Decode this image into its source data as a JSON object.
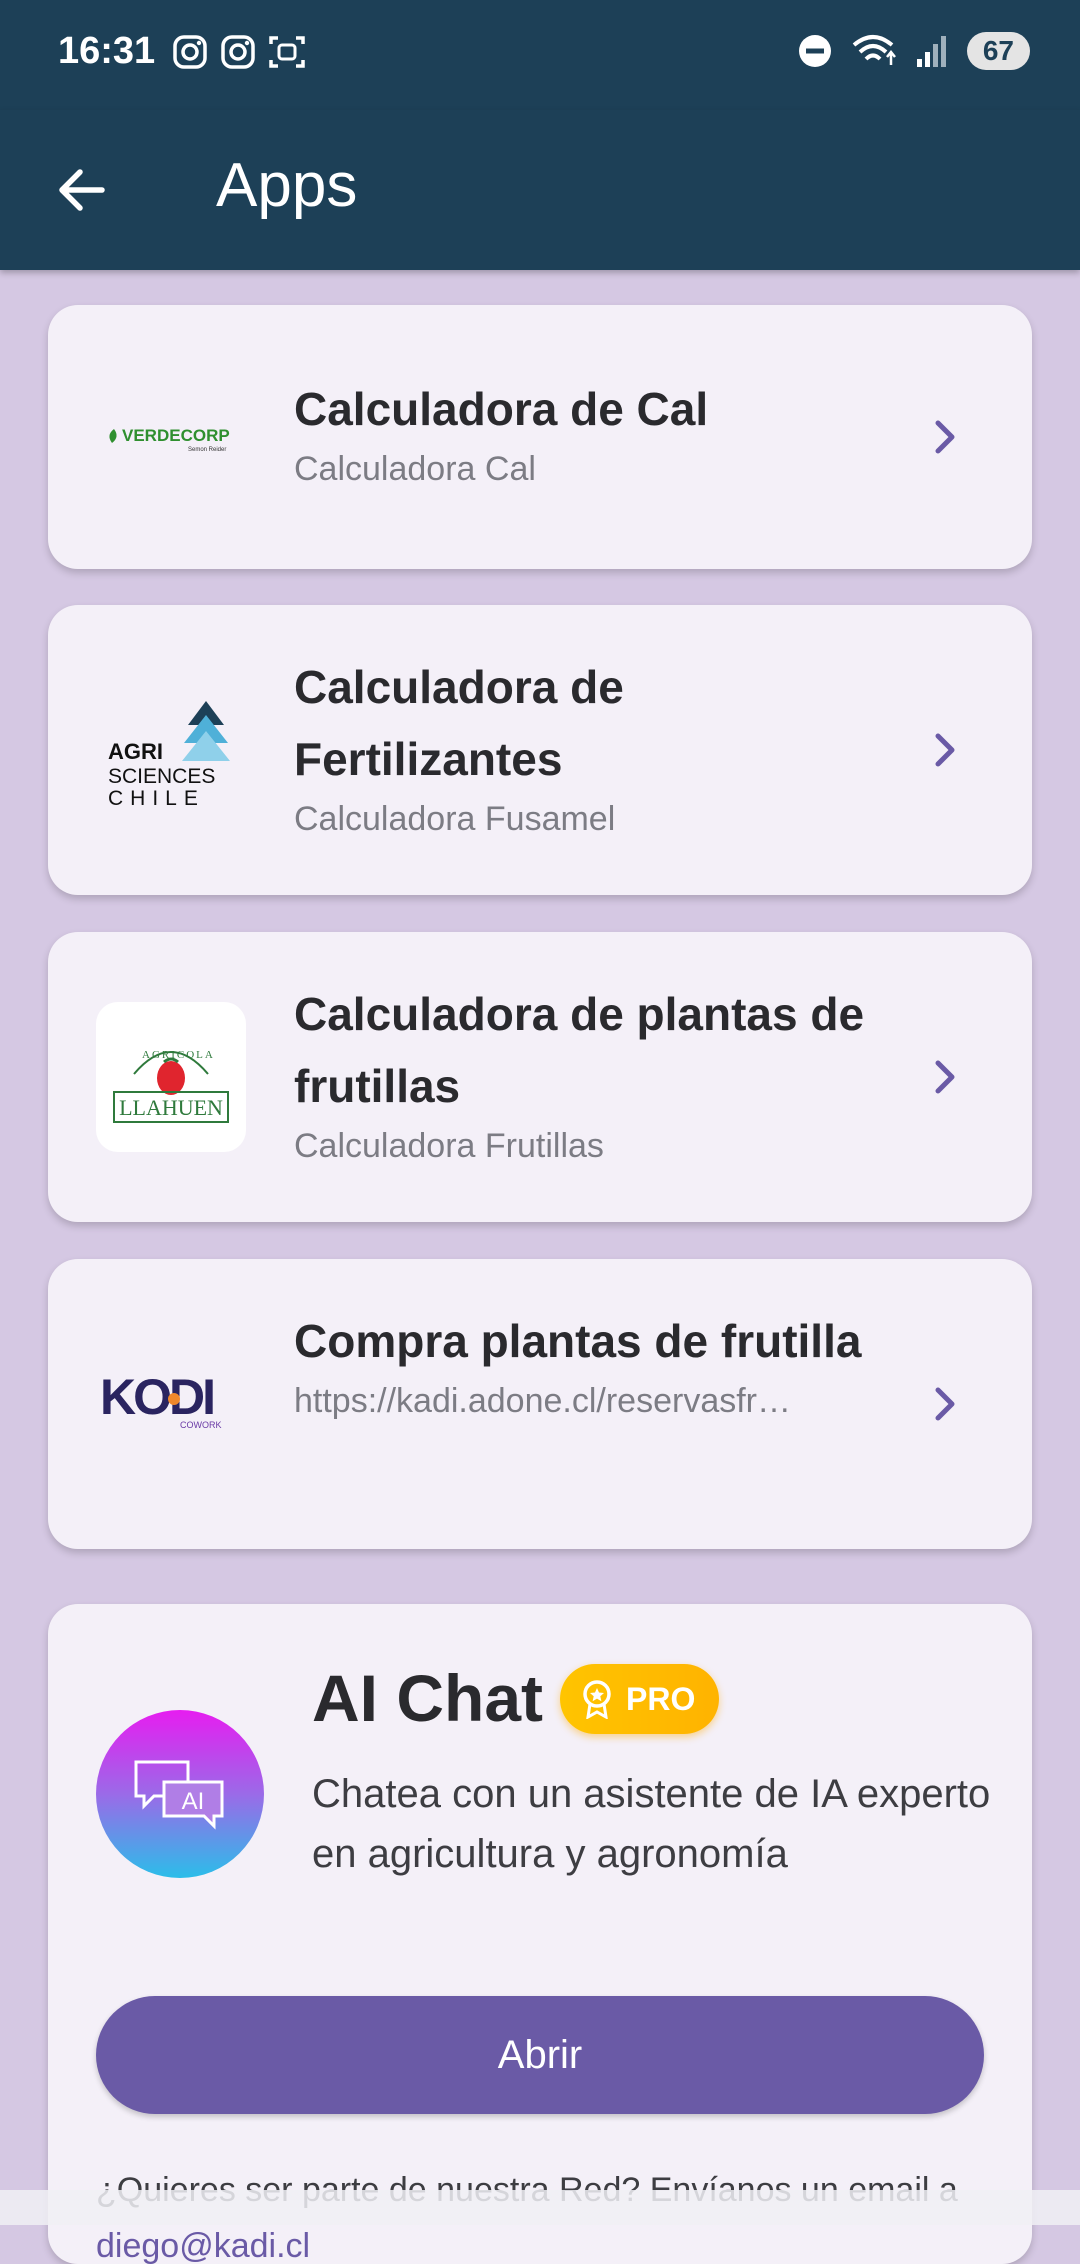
{
  "status_bar": {
    "time": "16:31",
    "battery": "67",
    "left_icons": [
      "instagram-icon",
      "instagram-icon",
      "screenshot-icon"
    ],
    "right_icons": [
      "do-not-disturb-icon",
      "wifi-icon",
      "signal-icon"
    ]
  },
  "app_bar": {
    "title": "Apps",
    "back_icon": "arrow-back-icon",
    "color": "#1d4057"
  },
  "apps": [
    {
      "title": "Calculadora de Cal",
      "subtitle": "Calculadora Cal",
      "logo_text": "VERDECORP",
      "logo_sub": "Semon Reider"
    },
    {
      "title": "Calculadora de Fertilizantes",
      "subtitle": "Calculadora Fusamel",
      "logo_lines": [
        "AGRI",
        "SCIENCES",
        "CHILE"
      ]
    },
    {
      "title": "Calculadora de plantas de frutillas",
      "subtitle": "Calculadora Frutillas",
      "logo_arc": "AGRICOLA",
      "logo_text": "LLAHUEN"
    },
    {
      "title": "Compra plantas de frutilla",
      "subtitle": "https://kadi.adone.cl/reservasfr…",
      "logo_text": "KODI",
      "logo_sub": "COWORK"
    }
  ],
  "ai_chat": {
    "title": "AI Chat",
    "badge": "PRO",
    "avatar_label": "AI",
    "description": "Chatea con un asistente de IA experto en agricultura y agronomía",
    "button": "Abrir",
    "footer": "¿Quieres ser parte de nuestra Red? Envíanos un email a",
    "footer_email": "diego@kadi.cl"
  },
  "colors": {
    "background": "#d5c8e3",
    "card": "#f4f0f8",
    "accent": "#6a5aa6",
    "badge": "#ffc400"
  }
}
